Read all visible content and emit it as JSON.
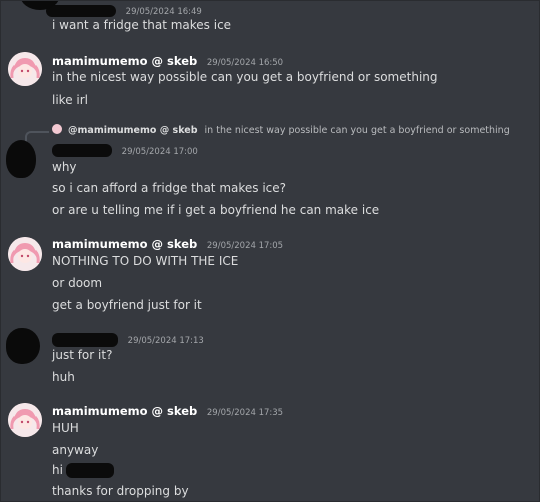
{
  "messages": [
    {
      "author": "",
      "timestamp": "29/05/2024 16:49",
      "lines": [
        "i want a fridge that makes ice"
      ]
    },
    {
      "author": "mamimumemo @ skeb",
      "timestamp": "29/05/2024 16:50",
      "lines": [
        "in the nicest way possible can you get a boyfriend or something",
        "like irl"
      ]
    },
    {
      "author": "",
      "timestamp": "29/05/2024 17:00",
      "reply": {
        "author": "@mamimumemo @ skeb",
        "text": "in the nicest way possible can you get a boyfriend or something"
      },
      "lines": [
        "why",
        "so i can afford a fridge that makes ice?",
        "or are u telling me if i get a boyfriend he can make ice"
      ]
    },
    {
      "author": "mamimumemo @ skeb",
      "timestamp": "29/05/2024 17:05",
      "lines": [
        "NOTHING TO DO WITH THE ICE",
        "or doom",
        "get a boyfriend just for it"
      ]
    },
    {
      "author": "",
      "timestamp": "29/05/2024 17:13",
      "lines": [
        "just for it?",
        "huh"
      ]
    },
    {
      "author": "mamimumemo @ skeb",
      "timestamp": "29/05/2024 17:35",
      "lines": [
        "HUH",
        "anyway",
        "hi",
        "thanks for dropping by"
      ]
    }
  ],
  "colors": {
    "background": "#36393f",
    "text": "#dcddde",
    "author": "#ffffff",
    "timestamp": "#a3a6aa",
    "redaction": "#0b0b0b"
  }
}
